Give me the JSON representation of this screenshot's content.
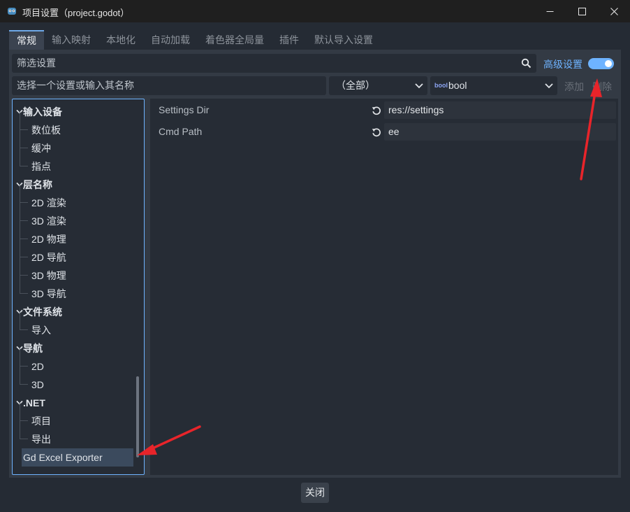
{
  "window": {
    "title": "项目设置（project.godot）",
    "minimize_glyph": "—",
    "maximize_glyph": "☐",
    "close_glyph": "✕"
  },
  "tabs": [
    {
      "label": "常规",
      "active": true
    },
    {
      "label": "输入映射",
      "active": false
    },
    {
      "label": "本地化",
      "active": false
    },
    {
      "label": "自动加载",
      "active": false
    },
    {
      "label": "着色器全局量",
      "active": false
    },
    {
      "label": "插件",
      "active": false
    },
    {
      "label": "默认导入设置",
      "active": false
    }
  ],
  "filter": {
    "placeholder": "筛选设置",
    "icon": "search-icon"
  },
  "advanced": {
    "label": "高级设置",
    "enabled": true
  },
  "add_row": {
    "name_placeholder": "选择一个设置或输入其名称",
    "scope_select": "（全部）",
    "type_icon_text": "bool",
    "type_select": "bool",
    "add_label": "添加",
    "delete_label": "删除"
  },
  "tree": [
    {
      "label": "输入设备",
      "kind": "section"
    },
    {
      "label": "数位板",
      "kind": "child"
    },
    {
      "label": "缓冲",
      "kind": "child"
    },
    {
      "label": "指点",
      "kind": "child"
    },
    {
      "label": "层名称",
      "kind": "section"
    },
    {
      "label": "2D 渲染",
      "kind": "child"
    },
    {
      "label": "3D 渲染",
      "kind": "child"
    },
    {
      "label": "2D 物理",
      "kind": "child"
    },
    {
      "label": "2D 导航",
      "kind": "child"
    },
    {
      "label": "3D 物理",
      "kind": "child"
    },
    {
      "label": "3D 导航",
      "kind": "child"
    },
    {
      "label": "文件系统",
      "kind": "section"
    },
    {
      "label": "导入",
      "kind": "child"
    },
    {
      "label": "导航",
      "kind": "section"
    },
    {
      "label": "2D",
      "kind": "child"
    },
    {
      "label": "3D",
      "kind": "child"
    },
    {
      "label": ".NET",
      "kind": "section"
    },
    {
      "label": "项目",
      "kind": "child"
    },
    {
      "label": "导出",
      "kind": "child"
    },
    {
      "label": "Gd Excel Exporter",
      "kind": "selected"
    }
  ],
  "properties": [
    {
      "label": "Settings Dir",
      "value": "res://settings"
    },
    {
      "label": "Cmd Path",
      "value": "ee"
    }
  ],
  "footer": {
    "close_label": "关闭"
  },
  "colors": {
    "accent": "#6eb3ff",
    "annotation_arrow": "#e8242a"
  }
}
